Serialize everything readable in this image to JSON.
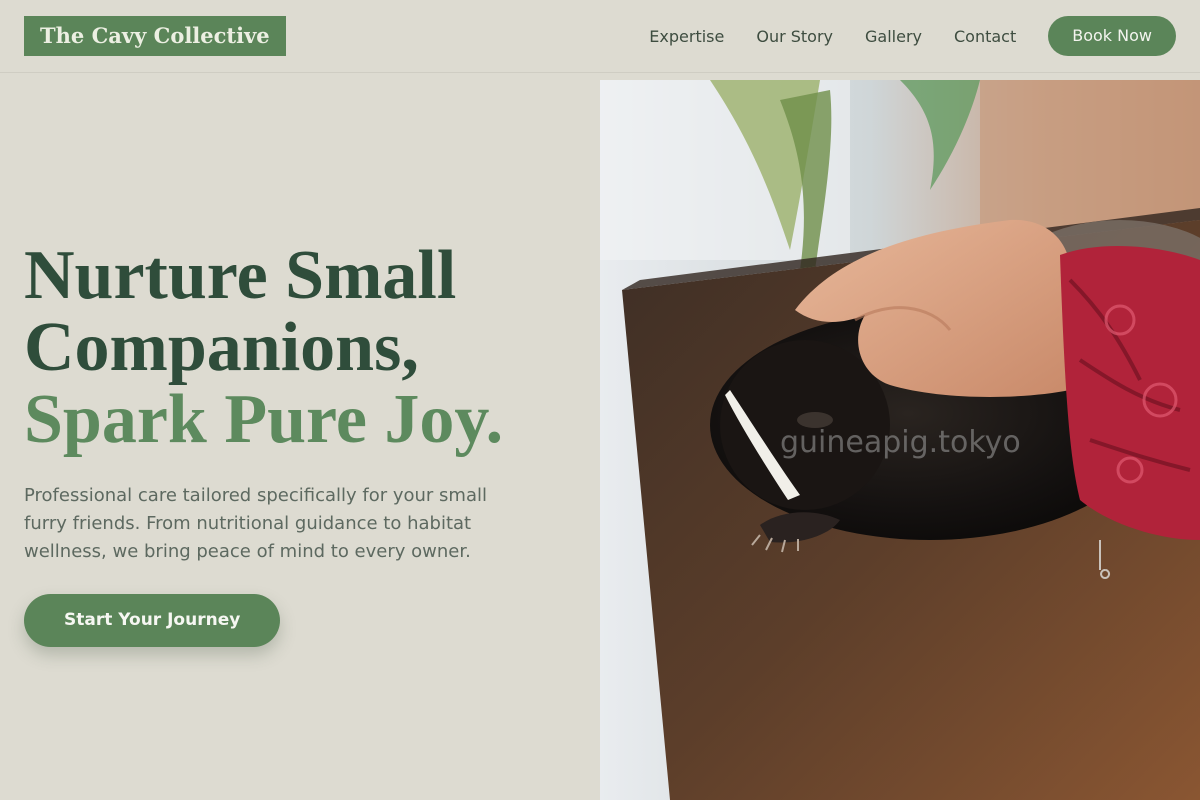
{
  "header": {
    "logo": "The Cavy Collective",
    "nav": [
      "Expertise",
      "Our Story",
      "Gallery",
      "Contact"
    ],
    "book_button": "Book Now"
  },
  "hero": {
    "headline_line1": "Nurture Small",
    "headline_line2": "Companions,",
    "headline_accent": "Spark Pure Joy.",
    "subtext": "Professional care tailored specifically for your small furry friends. From nutritional guidance to habitat wellness, we bring peace of mind to every owner.",
    "cta": "Start Your Journey"
  },
  "image": {
    "watermark": "guineapig.tokyo"
  },
  "colors": {
    "background": "#dddbd1",
    "brand_green": "#5b8559",
    "headline_dark": "#2f4d3b",
    "headline_accent": "#5d8a5e"
  }
}
